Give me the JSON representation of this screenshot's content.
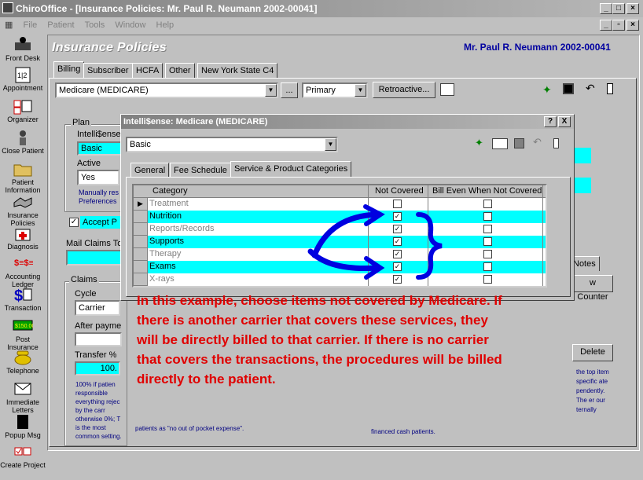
{
  "window": {
    "title": "ChiroOffice - [Insurance Policies: Mr. Paul R. Neumann 2002-00041]"
  },
  "menu": [
    "File",
    "Patient",
    "Tools",
    "Window",
    "Help"
  ],
  "sidebar": [
    {
      "label": "Front Desk",
      "icon": "desk-icon"
    },
    {
      "label": "Appointment",
      "icon": "calendar-icon"
    },
    {
      "label": "Organizer",
      "icon": "organizer-icon"
    },
    {
      "label": "Close Patient",
      "icon": "close-patient-icon"
    },
    {
      "label": "Patient Information",
      "icon": "folder-icon"
    },
    {
      "label": "Insurance Policies",
      "icon": "handshake-icon"
    },
    {
      "label": "Diagnosis",
      "icon": "medkit-icon"
    },
    {
      "label": "Accounting Ledger",
      "icon": "ledger-icon"
    },
    {
      "label": "Transaction",
      "icon": "dollar-icon"
    },
    {
      "label": "Post Insurance",
      "icon": "post-icon"
    },
    {
      "label": "Telephone",
      "icon": "phone-icon"
    },
    {
      "label": "Immediate Letters",
      "icon": "letter-icon"
    },
    {
      "label": "Popup Msg",
      "icon": "popup-icon"
    },
    {
      "label": "Create Project",
      "icon": "project-icon"
    }
  ],
  "header": {
    "title": "Insurance Policies",
    "patient": "Mr. Paul R. Neumann 2002-00041"
  },
  "tabs": [
    "Billing",
    "Subscriber",
    "HCFA",
    "Other",
    "New York State C4"
  ],
  "billing": {
    "carrier": "Medicare (MEDICARE)",
    "ellipsis": "...",
    "priority": "Primary",
    "retro_label": "Retroactive...",
    "plan_label": "Plan",
    "intellisense_label": "Intelli$ense",
    "intellisense_value": "Basic",
    "active_label": "Active",
    "active_value": "Yes",
    "manually_note": "Manually res",
    "preferences_note": "Preferences",
    "accept_label": "Accept P",
    "mail_claims_label": "Mail Claims To",
    "claims_label": "Claims",
    "cycle_label": "Cycle",
    "cycle_value": "Carrier",
    "after_payment_label": "After payme",
    "transfer_label": "Transfer %",
    "transfer_value": "100.",
    "claims_help": "100% if patien responsible everything rejec by the carr otherwise 0%; T is the most common setting.",
    "notes_tab": "Notes",
    "counter_btn": "w Counter",
    "delete_btn": "Delete",
    "right_help": "the top item specific ate pendently. The er our ternally",
    "bottom_help": "patients as \"no out of pocket expense\".",
    "financed_note": "financed cash patients."
  },
  "dialog": {
    "title": "Intelli$ense: Medicare (MEDICARE)",
    "help_btn": "?",
    "close_btn": "X",
    "plan_value": "Basic",
    "tabs": [
      "General",
      "Fee Schedule",
      "Service & Product Categories"
    ],
    "columns": [
      "Category",
      "Not Covered",
      "Bill Even When Not Covered"
    ],
    "rows": [
      {
        "category": "Treatment",
        "not_covered": false,
        "bill_even": false,
        "highlight": false,
        "disabled": true
      },
      {
        "category": "Nutrition",
        "not_covered": true,
        "bill_even": false,
        "highlight": true,
        "disabled": false
      },
      {
        "category": "Reports/Records",
        "not_covered": true,
        "bill_even": false,
        "highlight": false,
        "disabled": true
      },
      {
        "category": "Supports",
        "not_covered": true,
        "bill_even": false,
        "highlight": true,
        "disabled": false
      },
      {
        "category": "Therapy",
        "not_covered": true,
        "bill_even": false,
        "highlight": false,
        "disabled": true
      },
      {
        "category": "Exams",
        "not_covered": true,
        "bill_even": false,
        "highlight": true,
        "disabled": false
      },
      {
        "category": "X-rays",
        "not_covered": true,
        "bill_even": false,
        "highlight": false,
        "disabled": true
      }
    ]
  },
  "annotation": "In this example, choose items not covered by Medicare.  If there is another carrier that covers these services, they will be directly billed to that carrier.  If there is no carrier that covers the transactions, the procedures will be billed directly to the patient.",
  "colors": {
    "highlight": "#00ffff",
    "annotation": "#e00000",
    "arrow": "#0000e0",
    "name": "#0000a0"
  }
}
